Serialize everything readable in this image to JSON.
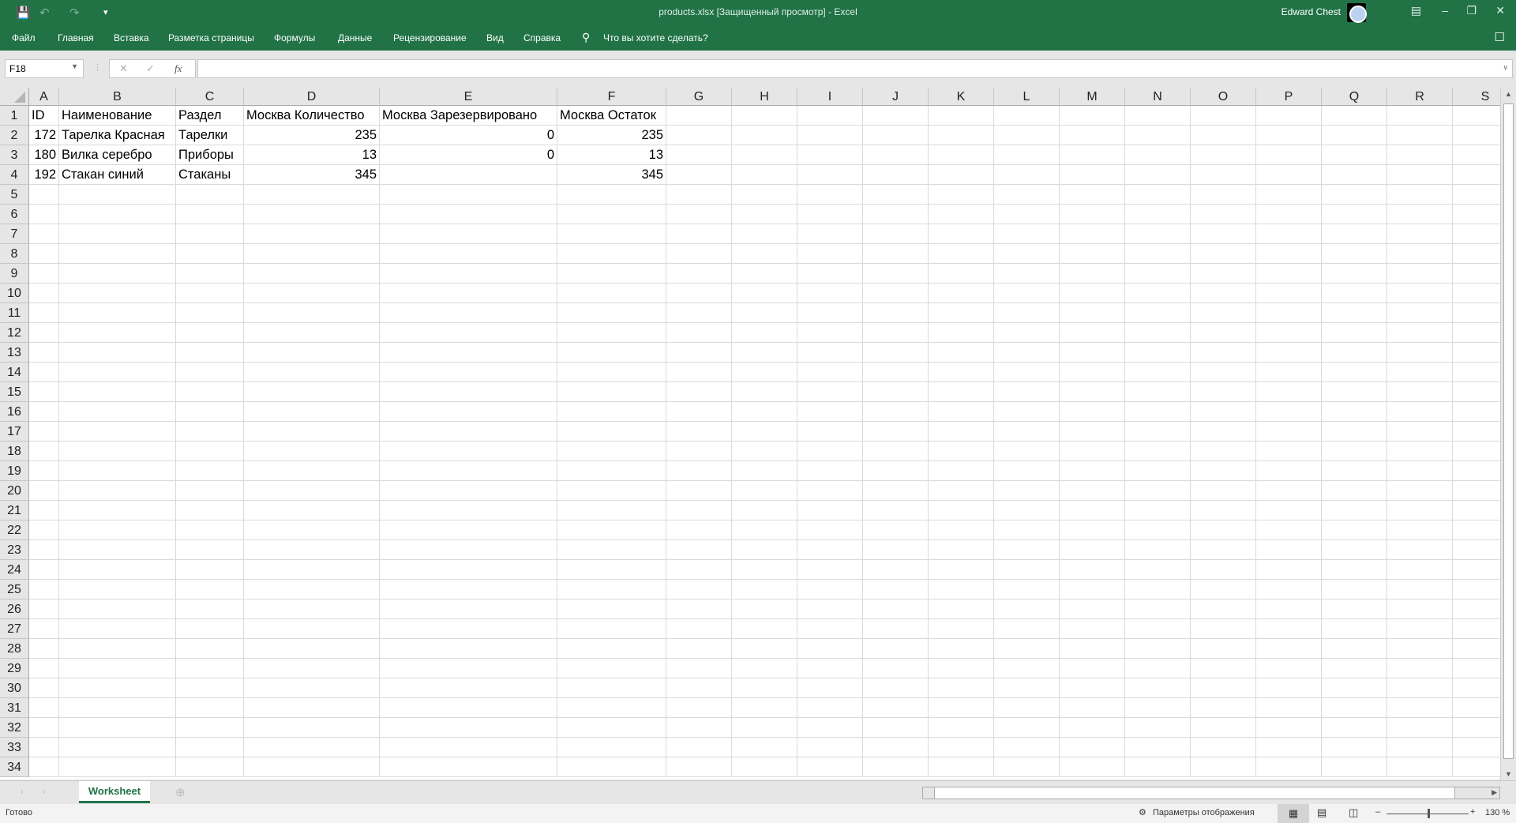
{
  "titlebar": {
    "title": "products.xlsx  [Защищенный просмотр]  -  Excel",
    "user": "Edward Chest"
  },
  "ribbon": {
    "tabs": [
      "Файл",
      "Главная",
      "Вставка",
      "Разметка страницы",
      "Формулы",
      "Данные",
      "Рецензирование",
      "Вид",
      "Справка"
    ],
    "search": "Что вы хотите сделать?"
  },
  "formula_bar": {
    "name_box": "F18",
    "value": ""
  },
  "columns": [
    "A",
    "B",
    "C",
    "D",
    "E",
    "F",
    "G",
    "H",
    "I",
    "J",
    "K",
    "L",
    "M",
    "N",
    "O",
    "P",
    "Q",
    "R",
    "S"
  ],
  "row_count": 34,
  "cells": [
    [
      "ID",
      "Наименование",
      "Раздел",
      "Москва Количество",
      "Москва Зарезервировано",
      "Москва Остаток"
    ],
    [
      "172",
      "Тарелка Красная",
      "Тарелки",
      "235",
      "0",
      "235"
    ],
    [
      "180",
      "Вилка серебро",
      "Приборы",
      "13",
      "0",
      "13"
    ],
    [
      "192",
      "Стакан синий",
      "Стаканы",
      "345",
      "",
      "345"
    ]
  ],
  "sheets": [
    "Worksheet"
  ],
  "status": {
    "ready": "Готово",
    "display_settings": "Параметры отображения",
    "zoom": "130 %"
  }
}
